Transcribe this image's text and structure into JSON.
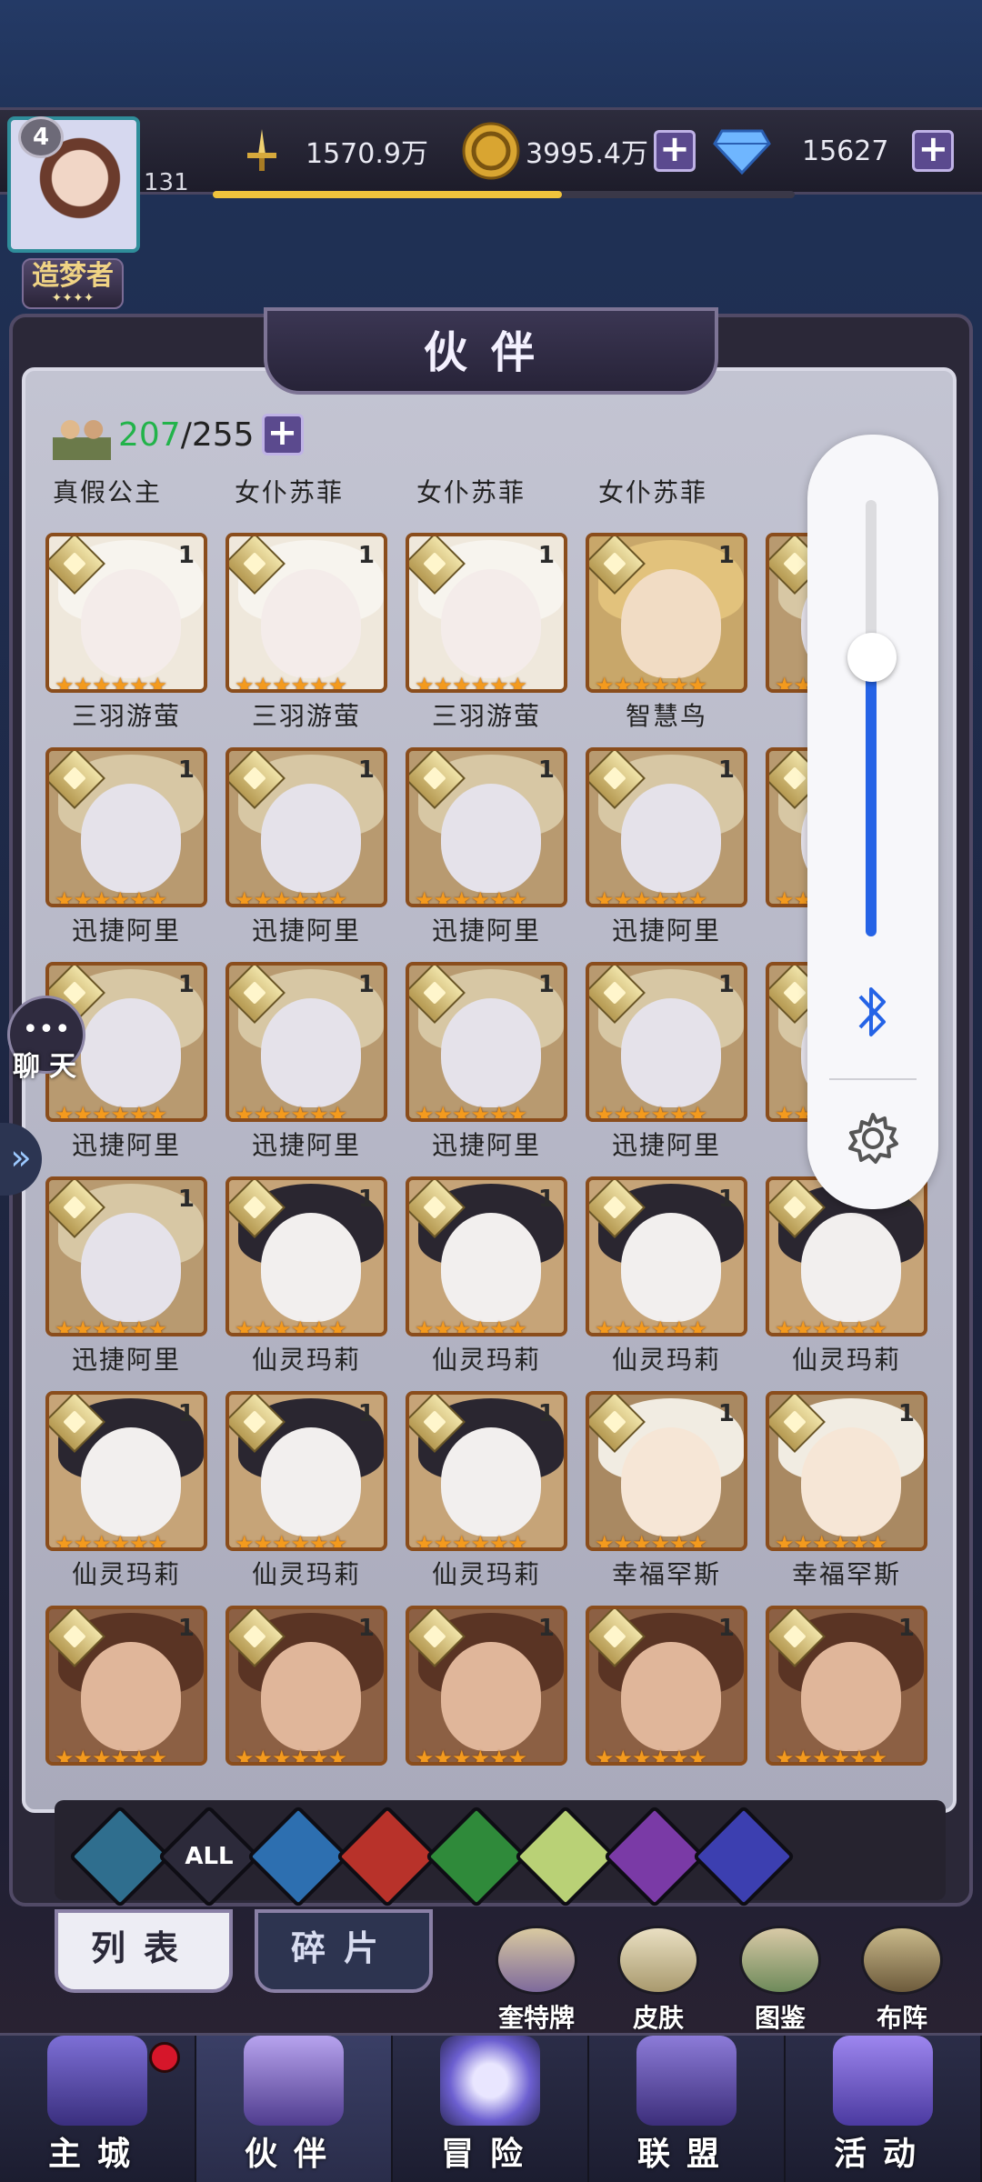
{
  "player": {
    "level": "4",
    "exp_level": "131",
    "title": "造梦者"
  },
  "resources": {
    "power": "1570.9万",
    "gold": "3995.4万",
    "diamonds": "15627",
    "exp_progress": 0.6
  },
  "panel": {
    "title": "伙伴"
  },
  "partner_count": {
    "current": "207",
    "max": "/255"
  },
  "top_row_names": [
    "真假公主",
    "女仆苏菲",
    "女仆苏菲",
    "女仆苏菲"
  ],
  "cards": [
    {
      "name": "三羽游萤",
      "level": "1",
      "style": "white"
    },
    {
      "name": "三羽游萤",
      "level": "1",
      "style": "white"
    },
    {
      "name": "三羽游萤",
      "level": "1",
      "style": "white"
    },
    {
      "name": "智慧鸟",
      "level": "1",
      "style": "blonde"
    },
    {
      "name": "迅",
      "level": "1",
      "style": "hood"
    },
    {
      "name": "迅捷阿里",
      "level": "1",
      "style": "hood"
    },
    {
      "name": "迅捷阿里",
      "level": "1",
      "style": "hood"
    },
    {
      "name": "迅捷阿里",
      "level": "1",
      "style": "hood"
    },
    {
      "name": "迅捷阿里",
      "level": "1",
      "style": "hood"
    },
    {
      "name": "迅",
      "level": "1",
      "style": "hood"
    },
    {
      "name": "迅捷阿里",
      "level": "1",
      "style": "hood"
    },
    {
      "name": "迅捷阿里",
      "level": "1",
      "style": "hood"
    },
    {
      "name": "迅捷阿里",
      "level": "1",
      "style": "hood"
    },
    {
      "name": "迅捷阿里",
      "level": "1",
      "style": "hood"
    },
    {
      "name": "迅",
      "level": "1",
      "style": "hood"
    },
    {
      "name": "迅捷阿里",
      "level": "1",
      "style": "hood"
    },
    {
      "name": "仙灵玛莉",
      "level": "1",
      "style": "dark"
    },
    {
      "name": "仙灵玛莉",
      "level": "1",
      "style": "dark"
    },
    {
      "name": "仙灵玛莉",
      "level": "1",
      "style": "dark"
    },
    {
      "name": "仙灵玛莉",
      "level": "1",
      "style": "dark"
    },
    {
      "name": "仙灵玛莉",
      "level": "1",
      "style": "dark"
    },
    {
      "name": "仙灵玛莉",
      "level": "1",
      "style": "dark"
    },
    {
      "name": "仙灵玛莉",
      "level": "1",
      "style": "dark"
    },
    {
      "name": "幸福罕斯",
      "level": "1",
      "style": "bandage"
    },
    {
      "name": "幸福罕斯",
      "level": "1",
      "style": "bandage"
    },
    {
      "name": "",
      "level": "1",
      "style": "brown"
    },
    {
      "name": "",
      "level": "1",
      "style": "brown"
    },
    {
      "name": "",
      "level": "1",
      "style": "brown"
    },
    {
      "name": "",
      "level": "1",
      "style": "brown"
    },
    {
      "name": "",
      "level": "1",
      "style": "brown"
    }
  ],
  "chat": {
    "label": "聊天"
  },
  "filters": [
    {
      "icon": "all-elements-icon",
      "label": "",
      "color": "#2f6e8e"
    },
    {
      "icon": "all-icon",
      "label": "ALL",
      "color": "#2c2a3a"
    },
    {
      "icon": "water-icon",
      "label": "",
      "color": "#2d6fb0"
    },
    {
      "icon": "fire-icon",
      "label": "",
      "color": "#b8322a"
    },
    {
      "icon": "wind-icon",
      "label": "",
      "color": "#2f8a3a"
    },
    {
      "icon": "light-icon",
      "label": "",
      "color": "#b9d176"
    },
    {
      "icon": "moon-icon",
      "label": "",
      "color": "#7a3aa6"
    },
    {
      "icon": "planet-icon",
      "label": "",
      "color": "#3c3fb0"
    }
  ],
  "tabs": {
    "list": "列表",
    "fragments": "碎片"
  },
  "tools": {
    "tarot": "奎特牌",
    "skin": "皮肤",
    "codex": "图鉴",
    "formation": "布阵"
  },
  "nav": {
    "main_city": "主城",
    "partners": "伙伴",
    "adventure": "冒险",
    "alliance": "联盟",
    "events": "活动"
  },
  "volume": {
    "level": 0.6
  }
}
